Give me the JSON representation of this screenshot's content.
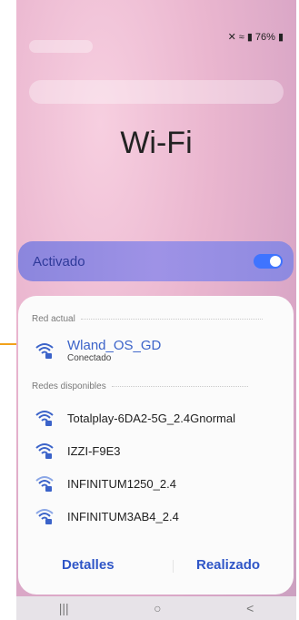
{
  "status": {
    "signal_icons": "mute wifi signal",
    "battery_pct": "76%"
  },
  "page": {
    "title": "Wi-Fi"
  },
  "toggle": {
    "label": "Activado",
    "state": "on"
  },
  "current_section": {
    "label": "Red actual"
  },
  "current_network": {
    "name": "Wland_OS_GD",
    "status": "Conectado",
    "icon": "wifi-lock-icon"
  },
  "available_section": {
    "label": "Redes disponibles"
  },
  "networks": [
    {
      "name": "Totalplay-6DA2-5G_2.4Gnormal"
    },
    {
      "name": "IZZI-F9E3"
    },
    {
      "name": "INFINITUM1250_2.4"
    },
    {
      "name": "INFINITUM3AB4_2.4"
    }
  ],
  "buttons": {
    "details": "Detalles",
    "done": "Realizado"
  },
  "nav": {
    "recent": "|||",
    "home": "○",
    "back": "<"
  },
  "colors": {
    "accent": "#3b63c9",
    "toggle_bg": "#8b86dd",
    "callout": "#f2a11b"
  }
}
